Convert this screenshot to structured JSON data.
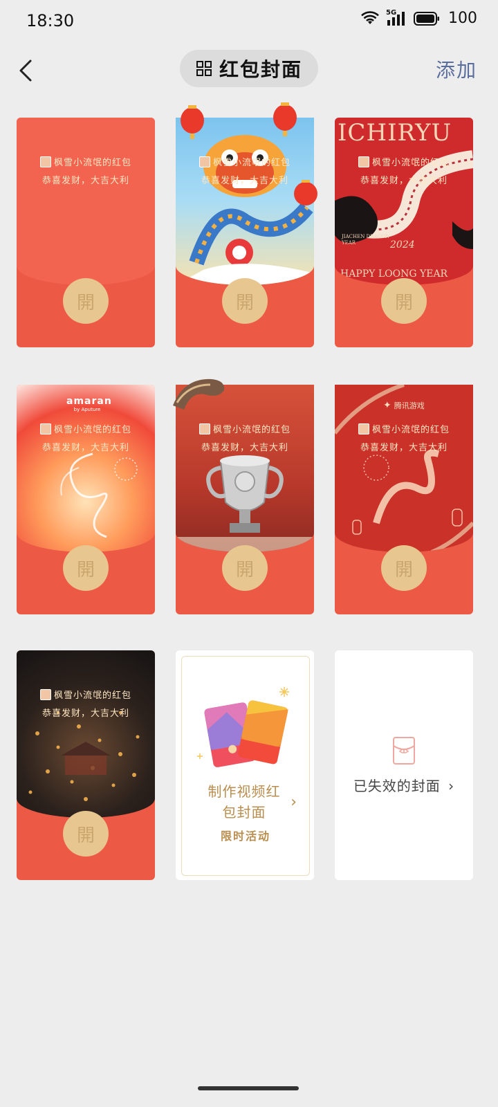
{
  "status": {
    "time": "18:30",
    "battery": "100",
    "network": "5G"
  },
  "nav": {
    "title": "红包封面",
    "add_label": "添加"
  },
  "cards": [
    {
      "owner": "枫雪小流氓的红包",
      "blessing": "恭喜发财，大吉大利",
      "open": "開"
    },
    {
      "owner": "枫雪小流氓的红包",
      "blessing": "恭喜发财，大吉大利",
      "open": "開"
    },
    {
      "owner": "枫雪小流氓的红包",
      "blessing": "恭喜发财，大吉大利",
      "open": "開",
      "brand": "ICHIRYU",
      "tagline": "HAPPY LOONG YEAR",
      "year": "2024",
      "subtitle": "JIACHEN DRAGON YEAR"
    },
    {
      "owner": "枫雪小流氓的红包",
      "blessing": "恭喜发财，大吉大利",
      "open": "開",
      "brand": "amaran",
      "brand_sub": "by Aputure"
    },
    {
      "owner": "枫雪小流氓的红包",
      "blessing": "恭喜发财，大吉大利",
      "open": "開"
    },
    {
      "owner": "枫雪小流氓的红包",
      "blessing": "恭喜发财，大吉大利",
      "open": "開",
      "brand": "腾讯游戏"
    },
    {
      "owner": "枫雪小流氓的红包",
      "blessing": "恭喜发财，大吉大利",
      "open": "開"
    }
  ],
  "make_card": {
    "title": "制作视频红包封面",
    "arrow": "›",
    "subtitle": "限时活动"
  },
  "expired_card": {
    "label": "已失效的封面",
    "arrow": "›"
  },
  "colors": {
    "red": "#ec5a45",
    "gold": "#e8c690",
    "link_blue": "#5a6e9e"
  }
}
